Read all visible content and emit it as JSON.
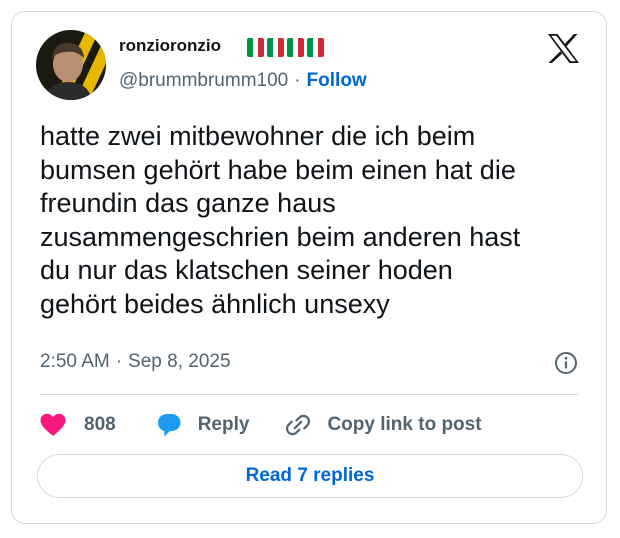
{
  "user": {
    "display_name": "ronzioronzio",
    "handle": "@brummbrumm100",
    "follow_label": "Follow",
    "flag_count": 4,
    "flag_colors": [
      "#009246",
      "#ffffff",
      "#ce2b37"
    ]
  },
  "tweet": {
    "text": "hatte zwei mitbewohner die ich beim\nbumsen gehört habe beim einen hat die\nfreundin das ganze haus\nzusammengeschrien beim anderen hast\ndu nur das klatschen seiner hoden\ngehört beides ähnlich unsexy",
    "time": "2:50 AM",
    "date": "Sep 8, 2025",
    "separator": "·"
  },
  "actions": {
    "like_count": "808",
    "reply_label": "Reply",
    "copy_link_label": "Copy link to post"
  },
  "read_replies_label": "Read 7 replies",
  "colors": {
    "heart": "#f91880",
    "reply_bubble": "#1d9bf0",
    "link_blue": "#0067d6",
    "muted": "#536471",
    "border": "#cfd9de"
  },
  "icons": [
    "avatar",
    "italy-flag-icon",
    "x-logo-icon",
    "info-icon",
    "heart-icon",
    "reply-bubble-icon",
    "link-icon"
  ]
}
